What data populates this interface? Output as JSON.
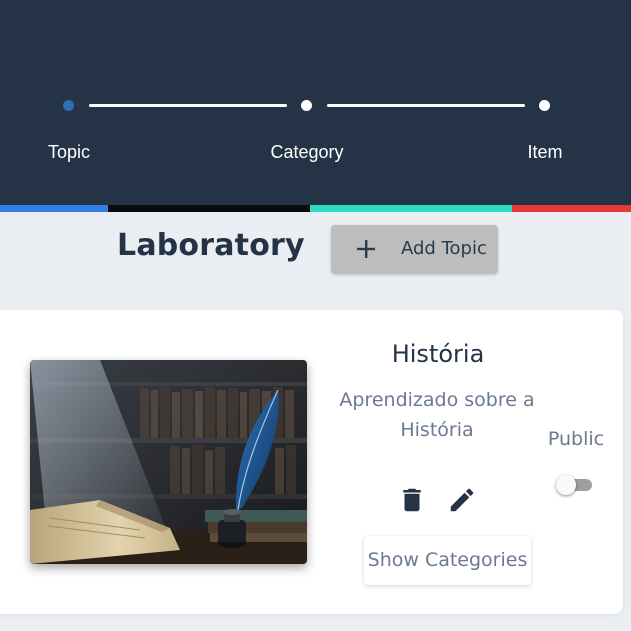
{
  "stepper": {
    "steps": [
      {
        "label": "Topic",
        "state": "active"
      },
      {
        "label": "Category",
        "state": "inactive"
      },
      {
        "label": "Item",
        "state": "inactive"
      }
    ]
  },
  "colors": {
    "header_bg": "#253346",
    "active_step": "#2f6db5",
    "bar_blue": "#2f7fe6",
    "bar_black": "#0b0b0b",
    "bar_teal": "#2bdcc0",
    "bar_red": "#e53935"
  },
  "page": {
    "title": "Laboratory",
    "add_button_label": "Add Topic",
    "add_button_icon": "plus-icon"
  },
  "topics": [
    {
      "title": "História",
      "description": "Aprendizado sobre a História",
      "image_alt": "quill-and-book-image",
      "delete_icon": "trash-icon",
      "edit_icon": "pencil-icon",
      "show_button_label": "Show Categories",
      "public_label": "Public",
      "public_enabled": false
    }
  ]
}
